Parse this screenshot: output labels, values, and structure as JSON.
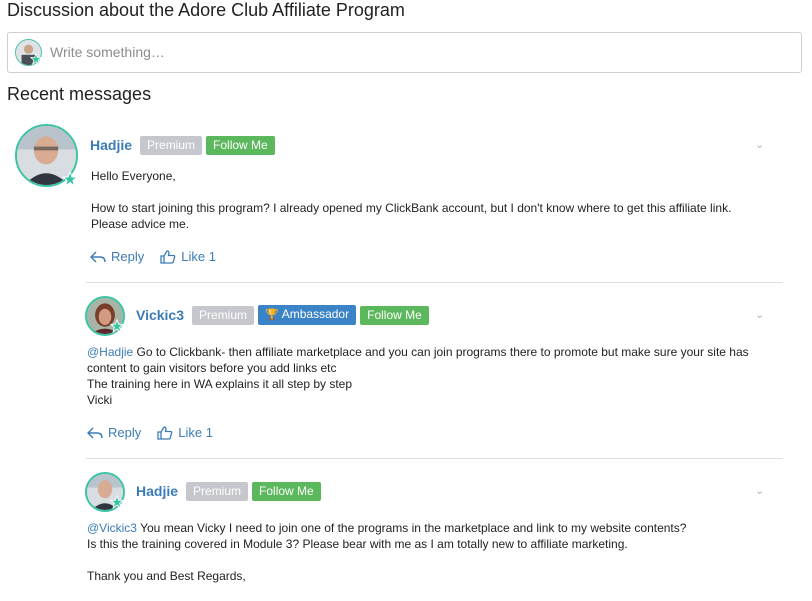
{
  "page": {
    "title": "Discussion about the Adore Club Affiliate Program",
    "composer_placeholder": "Write something…",
    "section_title": "Recent messages"
  },
  "messages": [
    {
      "author": "Hadjie",
      "badges": [
        "Premium"
      ],
      "follow_label": "Follow Me",
      "paragraphs": [
        "Hello Everyone,",
        "How to start joining this program? I already opened my ClickBank account, but I don't know where to get this affiliate link. Please advice me."
      ],
      "reply_label": "Reply",
      "like_label": "Like 1"
    },
    {
      "author": "Vickic3",
      "badges": [
        "Premium",
        "Ambassador"
      ],
      "follow_label": "Follow Me",
      "mention": "@Hadjie",
      "lines": [
        "Go to Clickbank- then affiliate marketplace and you can join programs there to promote but make sure your site has content to gain visitors before you add links etc",
        "The training here in WA explains it all step by step",
        "Vicki"
      ],
      "reply_label": "Reply",
      "like_label": "Like 1"
    },
    {
      "author": "Hadjie",
      "badges": [
        "Premium"
      ],
      "follow_label": "Follow Me",
      "mention": "@Vickic3",
      "lines": [
        "You mean Vicky I need to join one of the programs in the marketplace and link to my website contents?",
        "Is this the training covered in Module 3? Please bear with me as I am totally new to affiliate marketing.",
        "Thank you and Best Regards,"
      ]
    }
  ],
  "colors": {
    "author": "#3c7cb6",
    "premium": "#c5c7cc",
    "ambassador": "#3a83c6",
    "follow": "#5cb85c",
    "avatar_ring": "#3bc4a3"
  },
  "icons": [
    "reply-icon",
    "thumbs-up-icon",
    "chevron-down-icon",
    "trophy-icon",
    "star-badge-icon"
  ]
}
